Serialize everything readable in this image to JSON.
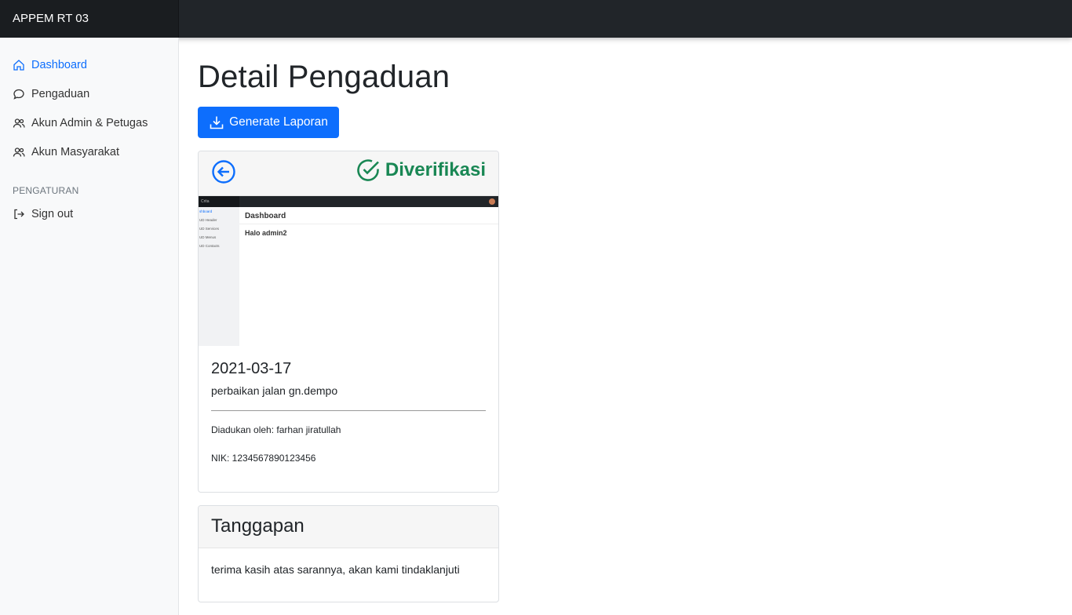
{
  "app": {
    "brand": "APPEM RT 03"
  },
  "sidebar": {
    "items": [
      {
        "label": "Dashboard",
        "icon": "home-icon",
        "active": true
      },
      {
        "label": "Pengaduan",
        "icon": "message-icon"
      },
      {
        "label": "Akun Admin & Petugas",
        "icon": "users-icon"
      },
      {
        "label": "Akun Masyarakat",
        "icon": "users-icon"
      }
    ],
    "heading": "PENGATURAN",
    "signout": {
      "label": "Sign out",
      "icon": "sign-out-icon"
    }
  },
  "main": {
    "title": "Detail Pengaduan",
    "generate_button": {
      "label": "Generate Laporan",
      "icon": "download-icon"
    }
  },
  "detail": {
    "status": "Diverifikasi",
    "status_color": "#198754",
    "accent_color": "#0d6efd",
    "attachment": {
      "brand": "Crita",
      "header": "Dashboard",
      "greeting": "Halo admin2",
      "side_links": [
        "shboard",
        "UD Header",
        "UD Services",
        "UD Menus",
        "UD Contacts"
      ]
    },
    "date": "2021-03-17",
    "description": "perbaikan jalan gn.dempo",
    "reported_by": "Diadukan oleh: farhan jiratullah",
    "nik": "NIK: 1234567890123456"
  },
  "response": {
    "title": "Tanggapan",
    "text": "terima kasih atas sarannya, akan kami tindaklanjuti"
  }
}
